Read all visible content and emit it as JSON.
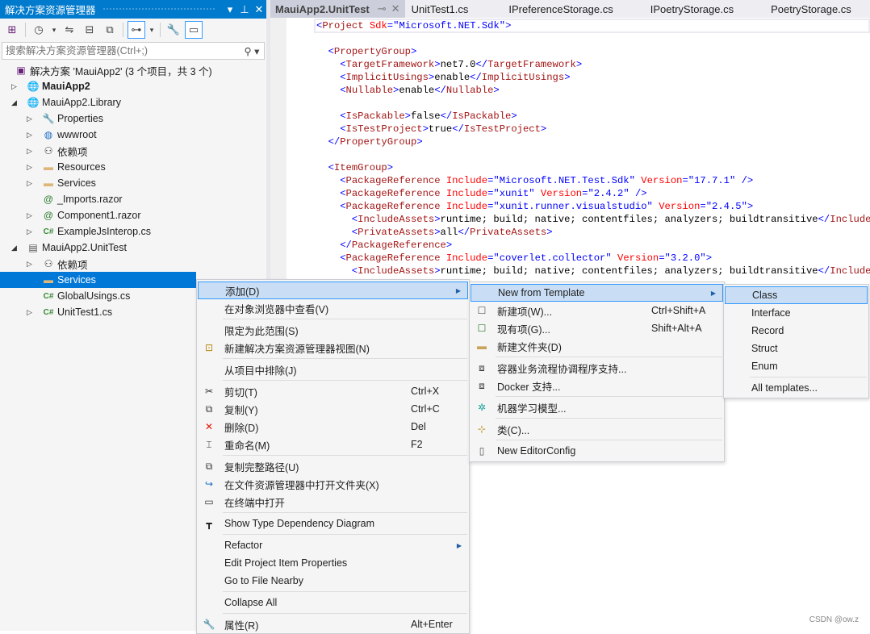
{
  "solution_explorer": {
    "title": "解决方案资源管理器",
    "title_buttons": [
      {
        "icon": "dropdown-icon",
        "glyph": "▾"
      },
      {
        "icon": "pin-icon",
        "glyph": "⊥"
      },
      {
        "icon": "close-icon",
        "glyph": "✕"
      }
    ],
    "search_placeholder": "搜索解决方案资源管理器(Ctrl+;)",
    "tree": [
      {
        "label": "解决方案 'MauiApp2' (3 个项目，共 3 个)",
        "level": 0,
        "icon": "solution-icon",
        "glyph": "▣",
        "color": "#68217a",
        "expander": ""
      },
      {
        "label": "MauiApp2",
        "level": 1,
        "icon": "project-icon",
        "glyph": "🌐",
        "color": "#1e6fc4",
        "expander": "▷",
        "bold": true
      },
      {
        "label": "MauiApp2.Library",
        "level": 1,
        "icon": "project-icon",
        "glyph": "🌐",
        "color": "#1e6fc4",
        "expander": "◢"
      },
      {
        "label": "Properties",
        "level": 2,
        "icon": "properties-icon",
        "glyph": "🔧",
        "color": "#7a5a1a",
        "expander": "▷"
      },
      {
        "label": "wwwroot",
        "level": 2,
        "icon": "globe-icon",
        "glyph": "◍",
        "color": "#1e6fc4",
        "expander": "▷"
      },
      {
        "label": "依赖项",
        "level": 2,
        "icon": "dependencies-icon",
        "glyph": "⚇",
        "color": "#333",
        "expander": "▷"
      },
      {
        "label": "Resources",
        "level": 2,
        "icon": "folder-icon",
        "glyph": "▬",
        "color": "#dcb67a",
        "expander": "▷"
      },
      {
        "label": "Services",
        "level": 2,
        "icon": "folder-icon",
        "glyph": "▬",
        "color": "#dcb67a",
        "expander": "▷"
      },
      {
        "label": "_Imports.razor",
        "level": 2,
        "icon": "razor-file-icon",
        "glyph": "@",
        "color": "#2b7a2b",
        "expander": ""
      },
      {
        "label": "Component1.razor",
        "level": 2,
        "icon": "razor-file-icon",
        "glyph": "@",
        "color": "#2b7a2b",
        "expander": "▷"
      },
      {
        "label": "ExampleJsInterop.cs",
        "level": 2,
        "icon": "csharp-file-icon",
        "glyph": "C#",
        "color": "#388a34",
        "expander": "▷"
      },
      {
        "label": "MauiApp2.UnitTest",
        "level": 1,
        "icon": "test-project-icon",
        "glyph": "▤",
        "color": "#555",
        "expander": "◢"
      },
      {
        "label": "依赖项",
        "level": 2,
        "icon": "dependencies-icon",
        "glyph": "⚇",
        "color": "#333",
        "expander": "▷"
      },
      {
        "label": "Services",
        "level": 2,
        "icon": "folder-icon",
        "glyph": "▬",
        "color": "#dcb67a",
        "expander": "",
        "selected": true
      },
      {
        "label": "GlobalUsings.cs",
        "level": 2,
        "icon": "csharp-file-icon",
        "glyph": "C#",
        "color": "#388a34",
        "expander": ""
      },
      {
        "label": "UnitTest1.cs",
        "level": 2,
        "icon": "csharp-file-icon",
        "glyph": "C#",
        "color": "#388a34",
        "expander": "▷"
      }
    ]
  },
  "tabs": [
    {
      "label": "MauiApp2.UnitTest",
      "active": true,
      "pin": "⊸",
      "close": "✕"
    },
    {
      "label": "UnitTest1.cs"
    },
    {
      "label": "IPreferenceStorage.cs"
    },
    {
      "label": "IPoetryStorage.cs"
    },
    {
      "label": "PoetryStorage.cs"
    }
  ],
  "code_lines": [
    {
      "indent": 0,
      "tokens": [
        [
          "p",
          "<"
        ],
        [
          "tag",
          "Project"
        ],
        [
          "attr",
          " Sdk"
        ],
        [
          "p",
          "=\""
        ],
        [
          "val",
          "Microsoft.NET.Sdk"
        ],
        [
          "p",
          "\">"
        ]
      ]
    },
    {
      "indent": 0,
      "tokens": []
    },
    {
      "indent": 1,
      "tokens": [
        [
          "p",
          "<"
        ],
        [
          "tag",
          "PropertyGroup"
        ],
        [
          "p",
          ">"
        ]
      ]
    },
    {
      "indent": 2,
      "tokens": [
        [
          "p",
          "<"
        ],
        [
          "tag",
          "TargetFramework"
        ],
        [
          "p",
          ">"
        ],
        [
          "txt",
          "net7.0"
        ],
        [
          "p",
          "</"
        ],
        [
          "tag",
          "TargetFramework"
        ],
        [
          "p",
          ">"
        ]
      ]
    },
    {
      "indent": 2,
      "tokens": [
        [
          "p",
          "<"
        ],
        [
          "tag",
          "ImplicitUsings"
        ],
        [
          "p",
          ">"
        ],
        [
          "txt",
          "enable"
        ],
        [
          "p",
          "</"
        ],
        [
          "tag",
          "ImplicitUsings"
        ],
        [
          "p",
          ">"
        ]
      ]
    },
    {
      "indent": 2,
      "tokens": [
        [
          "p",
          "<"
        ],
        [
          "tag",
          "Nullable"
        ],
        [
          "p",
          ">"
        ],
        [
          "txt",
          "enable"
        ],
        [
          "p",
          "</"
        ],
        [
          "tag",
          "Nullable"
        ],
        [
          "p",
          ">"
        ]
      ]
    },
    {
      "indent": 0,
      "tokens": []
    },
    {
      "indent": 2,
      "tokens": [
        [
          "p",
          "<"
        ],
        [
          "tag",
          "IsPackable"
        ],
        [
          "p",
          ">"
        ],
        [
          "txt",
          "false"
        ],
        [
          "p",
          "</"
        ],
        [
          "tag",
          "IsPackable"
        ],
        [
          "p",
          ">"
        ]
      ]
    },
    {
      "indent": 2,
      "tokens": [
        [
          "p",
          "<"
        ],
        [
          "tag",
          "IsTestProject"
        ],
        [
          "p",
          ">"
        ],
        [
          "txt",
          "true"
        ],
        [
          "p",
          "</"
        ],
        [
          "tag",
          "IsTestProject"
        ],
        [
          "p",
          ">"
        ]
      ]
    },
    {
      "indent": 1,
      "tokens": [
        [
          "p",
          "</"
        ],
        [
          "tag",
          "PropertyGroup"
        ],
        [
          "p",
          ">"
        ]
      ]
    },
    {
      "indent": 0,
      "tokens": []
    },
    {
      "indent": 1,
      "tokens": [
        [
          "p",
          "<"
        ],
        [
          "tag",
          "ItemGroup"
        ],
        [
          "p",
          ">"
        ]
      ]
    },
    {
      "indent": 2,
      "tokens": [
        [
          "p",
          "<"
        ],
        [
          "tag",
          "PackageReference"
        ],
        [
          "attr",
          " Include"
        ],
        [
          "p",
          "=\""
        ],
        [
          "val",
          "Microsoft.NET.Test.Sdk"
        ],
        [
          "p",
          "\""
        ],
        [
          "attr",
          " Version"
        ],
        [
          "p",
          "=\""
        ],
        [
          "val",
          "17.7.1"
        ],
        [
          "p",
          "\" />"
        ]
      ]
    },
    {
      "indent": 2,
      "tokens": [
        [
          "p",
          "<"
        ],
        [
          "tag",
          "PackageReference"
        ],
        [
          "attr",
          " Include"
        ],
        [
          "p",
          "=\""
        ],
        [
          "val",
          "xunit"
        ],
        [
          "p",
          "\""
        ],
        [
          "attr",
          " Version"
        ],
        [
          "p",
          "=\""
        ],
        [
          "val",
          "2.4.2"
        ],
        [
          "p",
          "\" />"
        ]
      ]
    },
    {
      "indent": 2,
      "tokens": [
        [
          "p",
          "<"
        ],
        [
          "tag",
          "PackageReference"
        ],
        [
          "attr",
          " Include"
        ],
        [
          "p",
          "=\""
        ],
        [
          "val",
          "xunit.runner.visualstudio"
        ],
        [
          "p",
          "\""
        ],
        [
          "attr",
          " Version"
        ],
        [
          "p",
          "=\""
        ],
        [
          "val",
          "2.4.5"
        ],
        [
          "p",
          "\">"
        ]
      ]
    },
    {
      "indent": 3,
      "tokens": [
        [
          "p",
          "<"
        ],
        [
          "tag",
          "IncludeAssets"
        ],
        [
          "p",
          ">"
        ],
        [
          "txt",
          "runtime; build; native; contentfiles; analyzers; buildtransitive"
        ],
        [
          "p",
          "</"
        ],
        [
          "tag",
          "IncludeAssets"
        ],
        [
          "p",
          ">"
        ]
      ]
    },
    {
      "indent": 3,
      "tokens": [
        [
          "p",
          "<"
        ],
        [
          "tag",
          "PrivateAssets"
        ],
        [
          "p",
          ">"
        ],
        [
          "txt",
          "all"
        ],
        [
          "p",
          "</"
        ],
        [
          "tag",
          "PrivateAssets"
        ],
        [
          "p",
          ">"
        ]
      ]
    },
    {
      "indent": 2,
      "tokens": [
        [
          "p",
          "</"
        ],
        [
          "tag",
          "PackageReference"
        ],
        [
          "p",
          ">"
        ]
      ]
    },
    {
      "indent": 2,
      "tokens": [
        [
          "p",
          "<"
        ],
        [
          "tag",
          "PackageReference"
        ],
        [
          "attr",
          " Include"
        ],
        [
          "p",
          "=\""
        ],
        [
          "val",
          "coverlet.collector"
        ],
        [
          "p",
          "\""
        ],
        [
          "attr",
          " Version"
        ],
        [
          "p",
          "=\""
        ],
        [
          "val",
          "3.2.0"
        ],
        [
          "p",
          "\">"
        ]
      ]
    },
    {
      "indent": 3,
      "tokens": [
        [
          "p",
          "<"
        ],
        [
          "tag",
          "IncludeAssets"
        ],
        [
          "p",
          ">"
        ],
        [
          "txt",
          "runtime; build; native; contentfiles; analyzers; buildtransitive"
        ],
        [
          "p",
          "</"
        ],
        [
          "tag",
          "IncludeAssets"
        ],
        [
          "p",
          ">"
        ]
      ]
    }
  ],
  "context_menu": [
    {
      "label": "添加(D)",
      "submenu": true,
      "highlighted": true
    },
    {
      "label": "在对象浏览器中查看(V)"
    },
    {
      "sep": true
    },
    {
      "label": "限定为此范围(S)"
    },
    {
      "label": "新建解决方案资源管理器视图(N)",
      "icon": "new-view-icon",
      "glyph": "⊡",
      "color": "#b8860b"
    },
    {
      "sep": true
    },
    {
      "label": "从项目中排除(J)"
    },
    {
      "sep": true
    },
    {
      "label": "剪切(T)",
      "shortcut": "Ctrl+X",
      "icon": "scissors-icon",
      "glyph": "✂",
      "color": "#333"
    },
    {
      "label": "复制(Y)",
      "shortcut": "Ctrl+C",
      "icon": "copy-icon",
      "glyph": "⧉",
      "color": "#333"
    },
    {
      "label": "删除(D)",
      "shortcut": "Del",
      "icon": "delete-icon",
      "glyph": "✕",
      "color": "#e51400"
    },
    {
      "label": "重命名(M)",
      "shortcut": "F2",
      "icon": "rename-icon",
      "glyph": "⌶",
      "color": "#333"
    },
    {
      "sep": true
    },
    {
      "label": "复制完整路径(U)",
      "icon": "copy-path-icon",
      "glyph": "⧉",
      "color": "#333"
    },
    {
      "label": "在文件资源管理器中打开文件夹(X)",
      "icon": "redo-arrow-icon",
      "glyph": "↪",
      "color": "#1e6fc4"
    },
    {
      "label": "在终端中打开",
      "icon": "terminal-icon",
      "glyph": "▭",
      "color": "#333"
    },
    {
      "sep": true
    },
    {
      "label": "Show Type Dependency Diagram",
      "icon": "diagram-icon",
      "glyph": "┳",
      "color": "#222"
    },
    {
      "sep": true
    },
    {
      "label": "Refactor",
      "submenu": true
    },
    {
      "label": "Edit Project Item Properties"
    },
    {
      "label": "Go to File Nearby"
    },
    {
      "sep": true
    },
    {
      "label": "Collapse All"
    },
    {
      "sep": true
    },
    {
      "label": "属性(R)",
      "shortcut": "Alt+Enter",
      "icon": "wrench-icon",
      "glyph": "🔧",
      "color": "#333"
    }
  ],
  "add_submenu": [
    {
      "label": "New from Template",
      "submenu": true,
      "highlighted": true
    },
    {
      "label": "新建项(W)...",
      "shortcut": "Ctrl+Shift+A",
      "icon": "new-item-icon",
      "glyph": "☐",
      "color": "#555"
    },
    {
      "label": "现有项(G)...",
      "shortcut": "Shift+Alt+A",
      "icon": "existing-item-icon",
      "glyph": "☐",
      "color": "#2b7a2b"
    },
    {
      "label": "新建文件夹(D)",
      "icon": "new-folder-icon",
      "glyph": "▬",
      "color": "#c8a45a"
    },
    {
      "sep": true
    },
    {
      "label": "容器业务流程协调程序支持...",
      "icon": "container-icon",
      "glyph": "⧈",
      "color": "#333"
    },
    {
      "label": "Docker 支持...",
      "icon": "docker-icon",
      "glyph": "⧈",
      "color": "#333"
    },
    {
      "sep": true
    },
    {
      "label": "机器学习模型...",
      "icon": "ml-model-icon",
      "glyph": "✲",
      "color": "#1ba39c"
    },
    {
      "sep": true
    },
    {
      "label": "类(C)...",
      "icon": "class-icon",
      "glyph": "⊹",
      "color": "#b8860b"
    },
    {
      "sep": true
    },
    {
      "label": "New EditorConfig",
      "icon": "file-icon",
      "glyph": "▯",
      "color": "#555"
    }
  ],
  "template_submenu": [
    {
      "label": "Class",
      "highlighted": true
    },
    {
      "label": "Interface"
    },
    {
      "label": "Record"
    },
    {
      "label": "Struct"
    },
    {
      "label": "Enum"
    },
    {
      "sep": true
    },
    {
      "label": "All templates..."
    }
  ],
  "watermark": "CSDN @ow.z"
}
